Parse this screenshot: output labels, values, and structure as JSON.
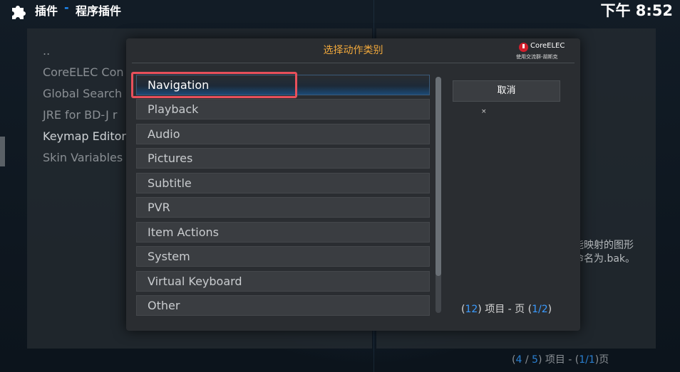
{
  "header": {
    "section": "插件",
    "separator": "-",
    "page_title": "程序插件",
    "clock": "下午 8:52"
  },
  "background_list": {
    "items": [
      {
        "label": ".."
      },
      {
        "label": "CoreELEC Con"
      },
      {
        "label": "Global Search"
      },
      {
        "label": "JRE for BD-J r"
      },
      {
        "label": "Keymap Editor"
      },
      {
        "label": "Skin Variables"
      }
    ]
  },
  "background_info": {
    "desc_line1": "能映射的图形",
    "desc_line2": "命名为.bak。",
    "footer": {
      "open": "(",
      "current": "4",
      "slash": " / ",
      "total": "5",
      "middle": ") 项目 - (",
      "page": "1/1",
      "close": ")页"
    }
  },
  "dialog": {
    "title": "选择动作类别",
    "brand_name": "CoreELEC",
    "brand_sub": "使用交流群-胡斯克",
    "items": [
      {
        "label": "Navigation"
      },
      {
        "label": "Playback"
      },
      {
        "label": "Audio"
      },
      {
        "label": "Pictures"
      },
      {
        "label": "Subtitle"
      },
      {
        "label": "PVR"
      },
      {
        "label": "Item Actions"
      },
      {
        "label": "System"
      },
      {
        "label": "Virtual Keyboard"
      },
      {
        "label": "Other"
      }
    ],
    "focused_index": 0,
    "cancel_label": "取消",
    "small_mark": "×",
    "footer": {
      "open": "(",
      "count": "12",
      "middle": ") 项目 - 页 (",
      "page": "1/2",
      "close": ")"
    }
  },
  "colors": {
    "accent_orange": "#f0a83c",
    "highlight_blue": "#3a9bff",
    "focus_ring": "#e8505b",
    "brand_red": "#d21e2b"
  },
  "icons": {
    "header_icon": "puzzle-piece-icon",
    "brand_icon": "power-icon"
  }
}
